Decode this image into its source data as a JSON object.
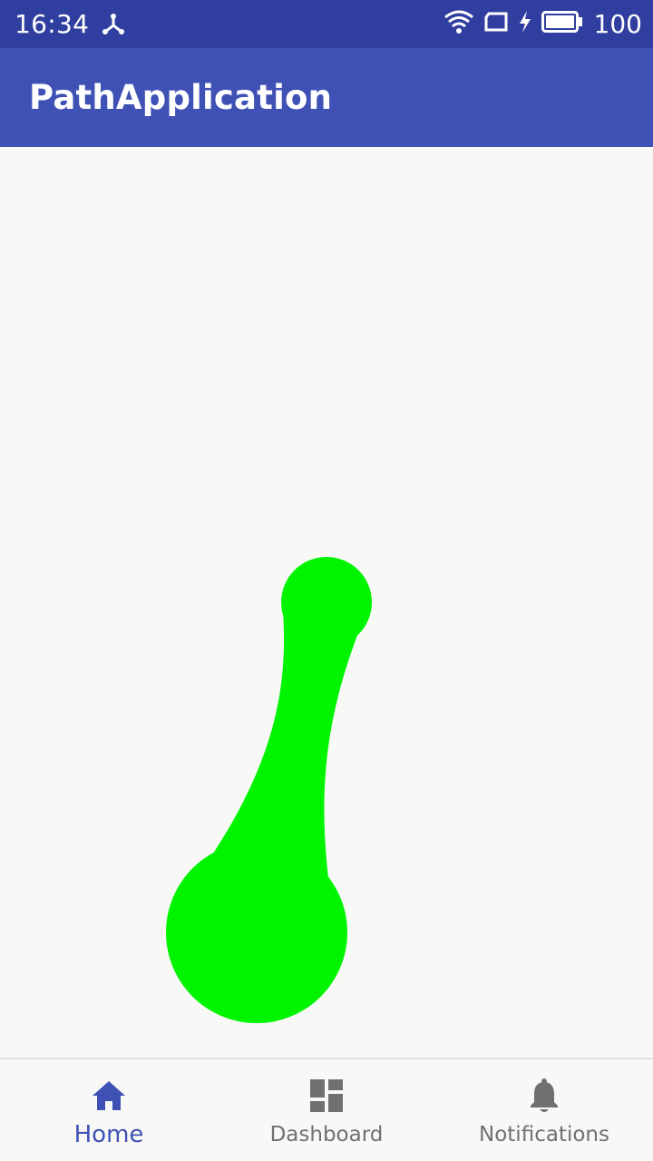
{
  "status_bar": {
    "time": "16:34",
    "battery": "100",
    "icons": [
      "usb-icon",
      "wifi-icon",
      "sim-icon",
      "charging-icon",
      "battery-icon"
    ]
  },
  "app_bar": {
    "title": "PathApplication"
  },
  "bottom_nav": {
    "items": [
      {
        "label": "Home",
        "icon": "home-icon",
        "selected": true
      },
      {
        "label": "Dashboard",
        "icon": "dashboard-icon",
        "selected": false
      },
      {
        "label": "Notifications",
        "icon": "bell-icon",
        "selected": false
      }
    ]
  },
  "colors": {
    "status_bar": "#303f9f",
    "app_bar": "#3f51b5",
    "blob": "#00f400",
    "active_nav": "#3f51b5",
    "inactive_nav": "#707070"
  }
}
